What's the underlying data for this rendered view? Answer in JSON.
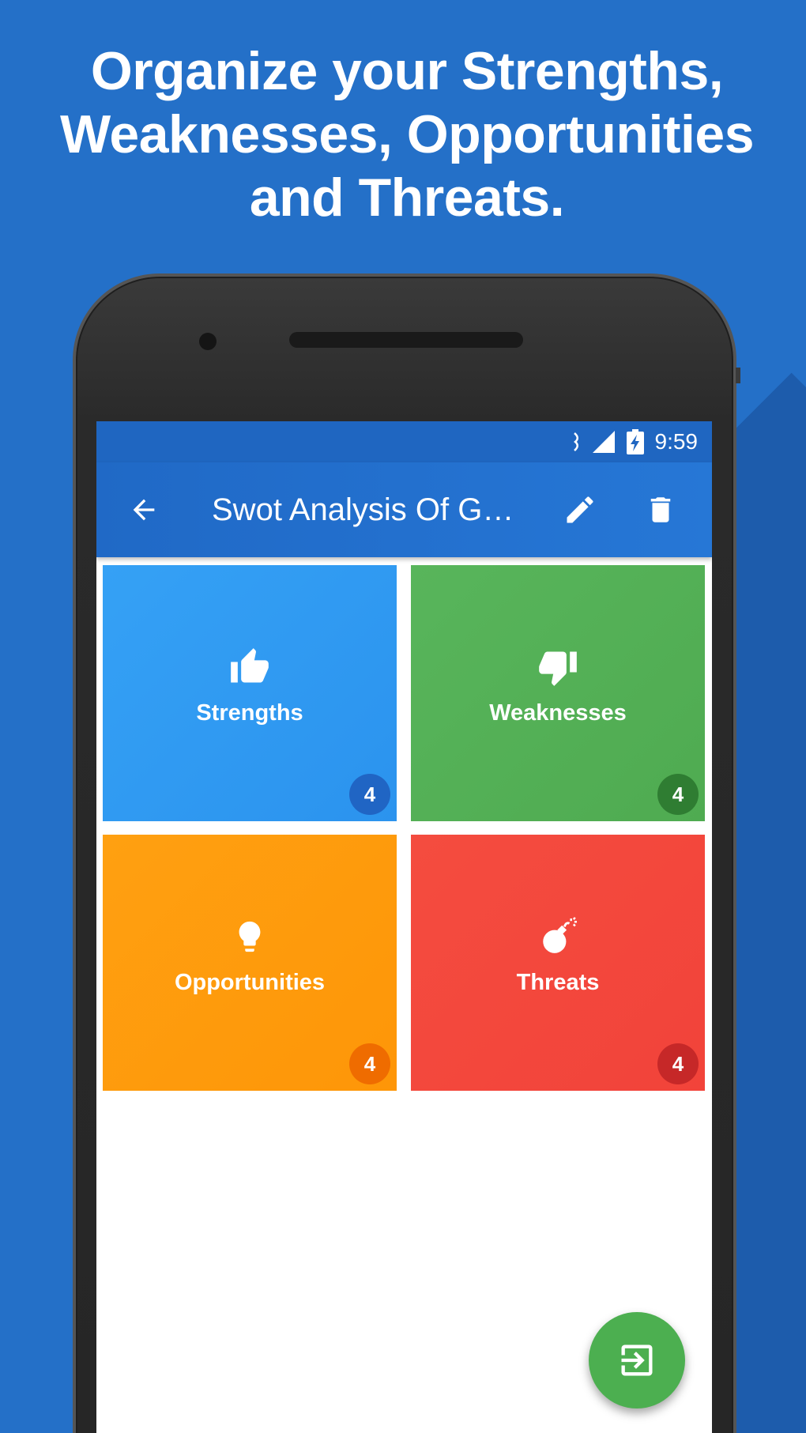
{
  "headline": {
    "line1": "Organize your Strengths,",
    "line2": "Weaknesses, Opportunities",
    "line3": "and Threats."
  },
  "status_bar": {
    "time": "9:59",
    "icons": [
      "data-transfer-icon",
      "signal-icon",
      "battery-charging-icon"
    ]
  },
  "app_bar": {
    "title": "Swot Analysis Of G…",
    "back_icon": "arrow-back-icon",
    "edit_icon": "pencil-icon",
    "delete_icon": "trash-icon"
  },
  "tiles": [
    {
      "label": "Strengths",
      "count": "4",
      "icon": "thumb-up-icon",
      "color": "#2e97f0",
      "badge_color": "#2065c4"
    },
    {
      "label": "Weaknesses",
      "count": "4",
      "icon": "thumb-down-icon",
      "color": "#53b054",
      "badge_color": "#2f7d32"
    },
    {
      "label": "Opportunities",
      "count": "4",
      "icon": "lightbulb-icon",
      "color": "#ff9a0c",
      "badge_color": "#ef6c00"
    },
    {
      "label": "Threats",
      "count": "4",
      "icon": "bomb-icon",
      "color": "#f3473c",
      "badge_color": "#c62828"
    }
  ],
  "fab": {
    "icon": "exit-to-app-icon",
    "color": "#4caf50"
  }
}
